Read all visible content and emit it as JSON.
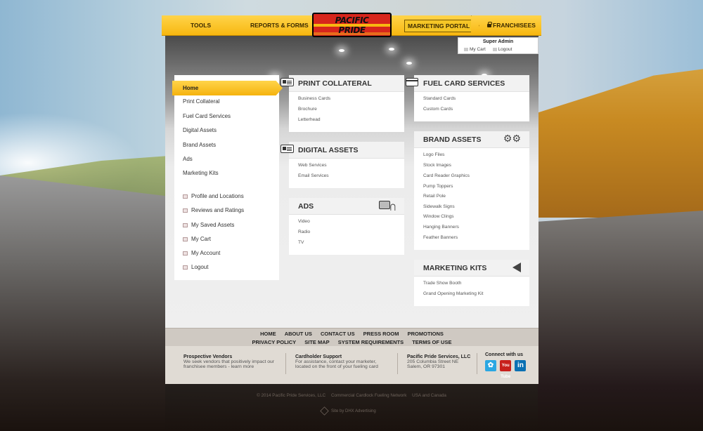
{
  "nav": {
    "tools": "TOOLS",
    "reports": "REPORTS & FORMS",
    "portal": "MARKETING PORTAL",
    "franchisees": "FRANCHISEES"
  },
  "logo": {
    "line1": "PACIFIC",
    "line2": "PRIDE"
  },
  "admin": {
    "name": "Super Admin",
    "cart": "My Cart",
    "logout": "Logout"
  },
  "sidebar": {
    "home": "Home",
    "items": [
      "Print Collateral",
      "Fuel Card Services",
      "Digital Assets",
      "Brand Assets",
      "Ads",
      "Marketing Kits"
    ],
    "account_items": [
      "Profile and Locations",
      "Reviews and Ratings",
      "My Saved Assets",
      "My Cart",
      "My Account",
      "Logout"
    ]
  },
  "cards": {
    "print": {
      "title": "PRINT COLLATERAL",
      "icon": "id-card-icon",
      "links": [
        "Business Cards",
        "Brochure",
        "Letterhead"
      ]
    },
    "digital": {
      "title": "DIGITAL ASSETS",
      "icon": "id-card-icon",
      "links": [
        "Web Services",
        "Email Services"
      ]
    },
    "ads": {
      "title": "ADS",
      "icon": "tv-antenna-icon",
      "links": [
        "Video",
        "Radio",
        "TV"
      ]
    },
    "fuel": {
      "title": "FUEL CARD SERVICES",
      "icon": "credit-card-icon",
      "links": [
        "Standard Cards",
        "Custom Cards"
      ]
    },
    "brand": {
      "title": "BRAND ASSETS",
      "icon": "gear-icon",
      "links": [
        "Logo Files",
        "Stock Images",
        "Card Reader Graphics",
        "Pump Toppers",
        "Retail Pole",
        "Sidewalk Signs",
        "Window Clings",
        "Hanging Banners",
        "Feather Banners"
      ]
    },
    "kits": {
      "title": "MARKETING KITS",
      "icon": "megaphone-icon",
      "links": [
        "Trade Show Booth",
        "Grand Opening Marketing Kit"
      ]
    }
  },
  "footer_nav": {
    "row1": [
      "HOME",
      "ABOUT US",
      "CONTACT US",
      "PRESS ROOM",
      "PROMOTIONS"
    ],
    "row2": [
      "PRIVACY POLICY",
      "SITE MAP",
      "SYSTEM REQUIREMENTS",
      "TERMS OF USE"
    ]
  },
  "footer_info": {
    "vendors": {
      "title": "Prospective Vendors",
      "line1": "We seek vendors that positively impact our",
      "line2": "franchisee members - learn more"
    },
    "support": {
      "title": "Cardholder Support",
      "line1": "For assistance, contact your marketer,",
      "line2": "located on the front of your fueling card"
    },
    "company": {
      "title": "Pacific Pride Services, LLC",
      "line1": "205 Columbia Street NE",
      "line2": "Salem, OR 97301"
    },
    "social": {
      "title": "Connect with us",
      "icons": [
        "twitter-icon",
        "youtube-icon",
        "linkedin-icon"
      ],
      "youtube_label": "You Tube"
    }
  },
  "copyright": [
    "© 2014 Pacific Pride Services, LLC",
    "Commercial Cardlock Fueling Network",
    "USA and Canada"
  ],
  "credit": "Site by DHX Advertising"
}
